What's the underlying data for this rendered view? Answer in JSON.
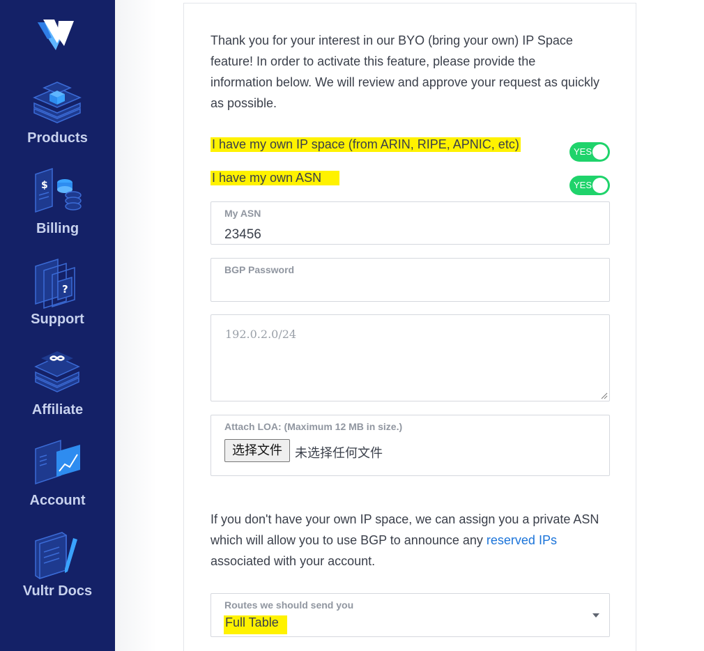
{
  "sidebar": {
    "items": [
      {
        "label": "Products",
        "icon": "products-icon"
      },
      {
        "label": "Billing",
        "icon": "billing-icon"
      },
      {
        "label": "Support",
        "icon": "support-icon"
      },
      {
        "label": "Affiliate",
        "icon": "affiliate-icon"
      },
      {
        "label": "Account",
        "icon": "account-icon"
      },
      {
        "label": "Vultr Docs",
        "icon": "docs-icon"
      }
    ]
  },
  "form": {
    "intro": "Thank you for your interest in our BYO (bring your own) IP Space feature! In order to activate this feature, please provide the information below. We will review and approve your request as quickly as possible.",
    "own_ip_label": "I have my own IP space (from ARIN, RIPE, APNIC, etc)",
    "own_ip_toggle": "YES",
    "own_asn_label": "I have my own ASN",
    "own_asn_toggle": "YES",
    "asn_label": "My ASN",
    "asn_value": "23456",
    "bgp_label": "BGP Password",
    "bgp_value": "",
    "prefix_placeholder": "192.0.2.0/24",
    "loa_label": "Attach LOA: (Maximum 12 MB in size.)",
    "file_button": "选择文件",
    "file_status": "未选择任何文件",
    "private_asn_text_before": "If you don't have your own IP space, we can assign you a private ASN which will allow you to use BGP to announce any ",
    "private_asn_link": "reserved IPs",
    "private_asn_text_after": " associated with your account.",
    "routes_label": "Routes we should send you",
    "routes_value": "Full Table"
  },
  "colors": {
    "sidebar_bg": "#142167",
    "toggle_on": "#1fd36b",
    "highlight": "#fff200",
    "link": "#1a73d9"
  }
}
